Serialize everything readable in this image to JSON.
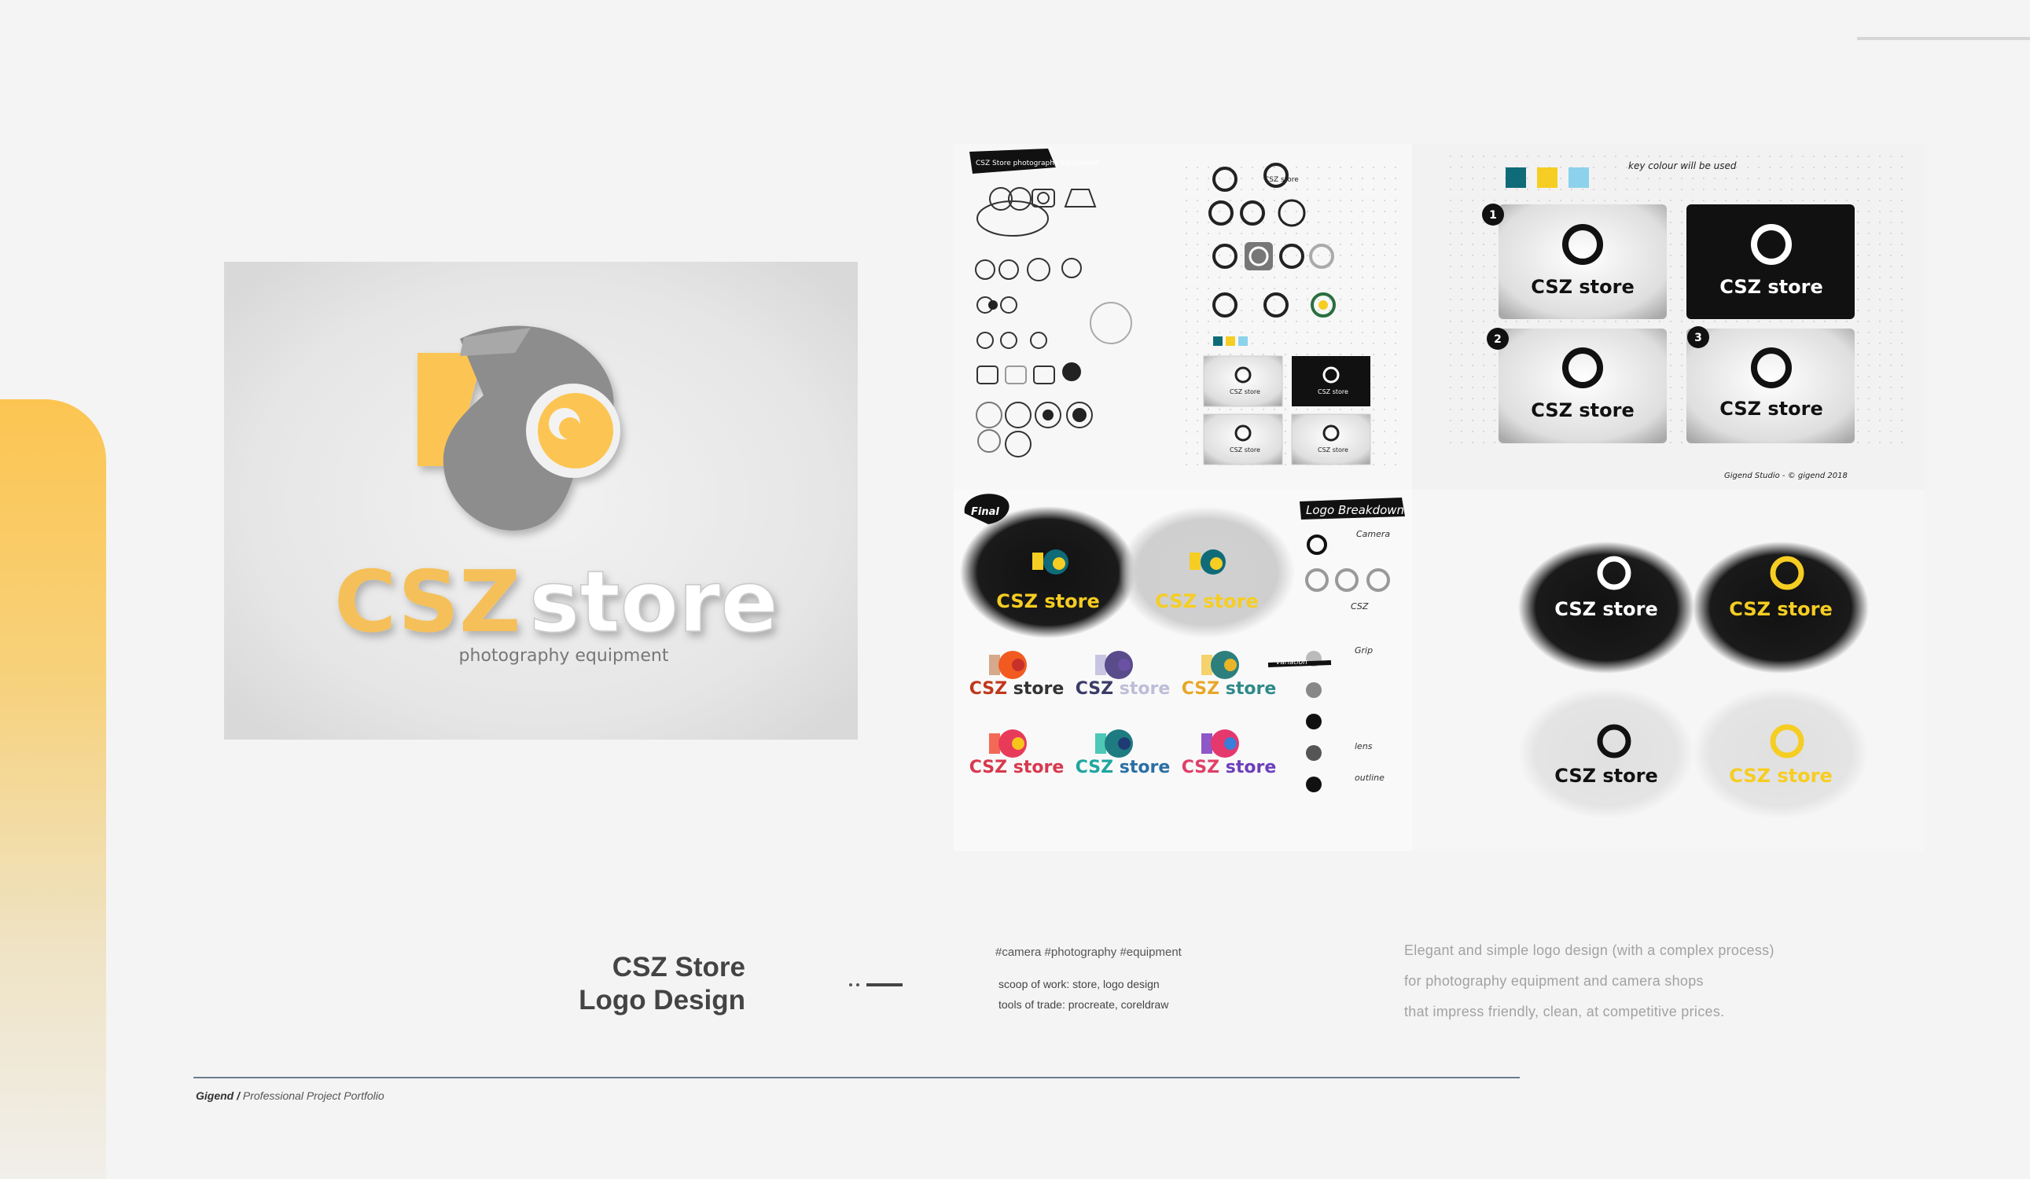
{
  "hero": {
    "logo_word_1": "CSZ",
    "logo_word_2": "store",
    "tagline": "photography equipment"
  },
  "board": {
    "sketch_label": "CSZ Store photography equipment",
    "key_colour_note": "key colour will be used",
    "numbers": [
      "1",
      "2",
      "3"
    ],
    "final_badge": "Final",
    "breakdown_title": "Logo Breakdown",
    "breakdown_notes": [
      "Camera",
      "CSZ",
      "Grip",
      "lens",
      "outline"
    ],
    "variation_label": "variation",
    "signature": "Gigend Studio - © gigend 2018",
    "mini_logo_text": "CSZ store",
    "mini_tagline": "photography equipment",
    "swatch_colors": [
      "#0f6b78",
      "#f6cd22",
      "#8cd2ec"
    ],
    "color_variants": [
      {
        "c1": "#d6a98c",
        "c2": "#f25a20",
        "dot": "#c7312a",
        "text1": "#c0381e",
        "text2": "#333333"
      },
      {
        "c1": "#c8c5e2",
        "c2": "#5a4b8b",
        "dot": "#6a51a3",
        "text1": "#3b3b68",
        "text2": "#bdbdd8"
      },
      {
        "c1": "#f4d36e",
        "c2": "#2c7f7c",
        "dot": "#e9b627",
        "text1": "#e7a72a",
        "text2": "#2f8a89"
      },
      {
        "c1": "#f26a55",
        "c2": "#e83b5a",
        "dot": "#f7c51c",
        "text1": "#d7394f",
        "text2": "#d7394f"
      },
      {
        "c1": "#4dc8b6",
        "c2": "#1f7b82",
        "dot": "#1e3c73",
        "text1": "#1fa6a0",
        "text2": "#2a6fa3"
      },
      {
        "c1": "#8f58c8",
        "c2": "#e5386d",
        "dot": "#3a7ed8",
        "text1": "#e03f67",
        "text2": "#6c3fbb"
      }
    ]
  },
  "project": {
    "title_line_1": "CSZ Store",
    "title_line_2": "Logo Design",
    "hashtags": "#camera #photography #equipment",
    "scope": "scoop of work: store, logo design",
    "tools": "tools of trade: procreate, coreldraw",
    "description_lines": [
      "Elegant and simple logo design (with a complex process)",
      "for photography equipment and camera shops",
      "that impress friendly, clean, at competitive prices."
    ]
  },
  "footer": {
    "brand": "Gigend /",
    "subtitle": "Professional Project Portfolio"
  },
  "colors": {
    "accent_yellow": "#fcc552",
    "logo_gray": "#8d8d8d",
    "rule_blue": "#6b7c90"
  }
}
